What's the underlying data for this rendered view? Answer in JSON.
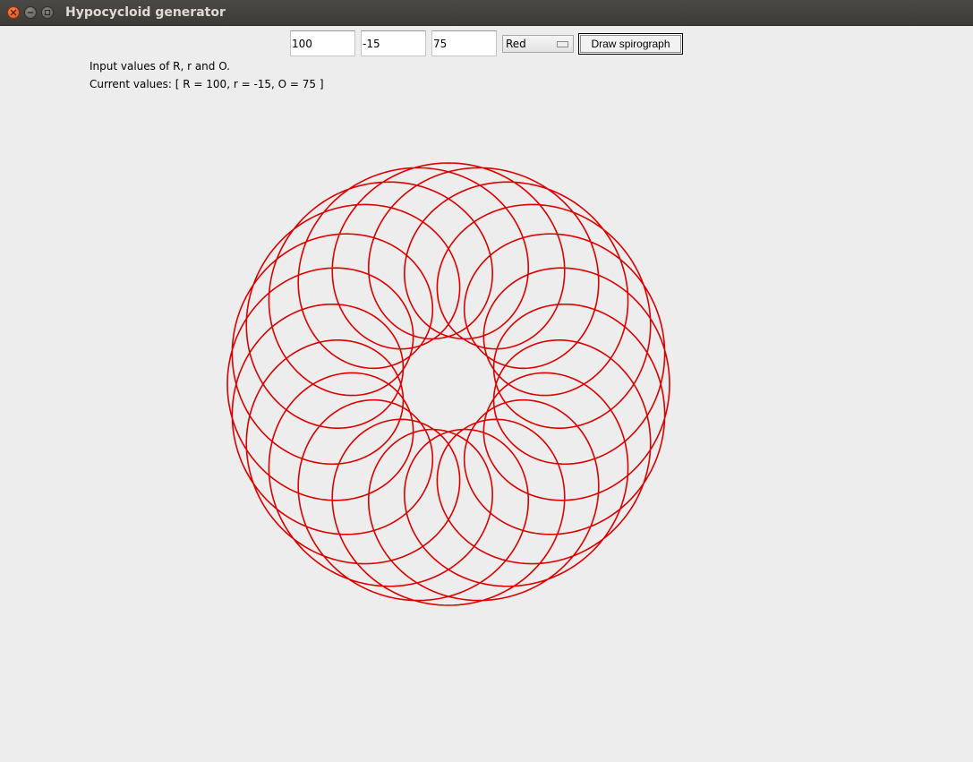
{
  "window": {
    "title": "Hypocycloid generator"
  },
  "inputs": {
    "R_value": "100",
    "r_value": "-15",
    "O_value": "75"
  },
  "color_select": {
    "selected": "Red"
  },
  "draw_button": {
    "label": "Draw spirograph"
  },
  "labels": {
    "instruction": "Input values of R, r and O.",
    "current_values": "Current values: [ R = 100, r = -15, O = 75 ]"
  },
  "spirograph": {
    "R": 100,
    "r": -15,
    "O": 75,
    "color": "#dd0000"
  },
  "icons": {
    "close": "close-icon",
    "minimize": "minimize-icon",
    "maximize": "maximize-icon"
  }
}
